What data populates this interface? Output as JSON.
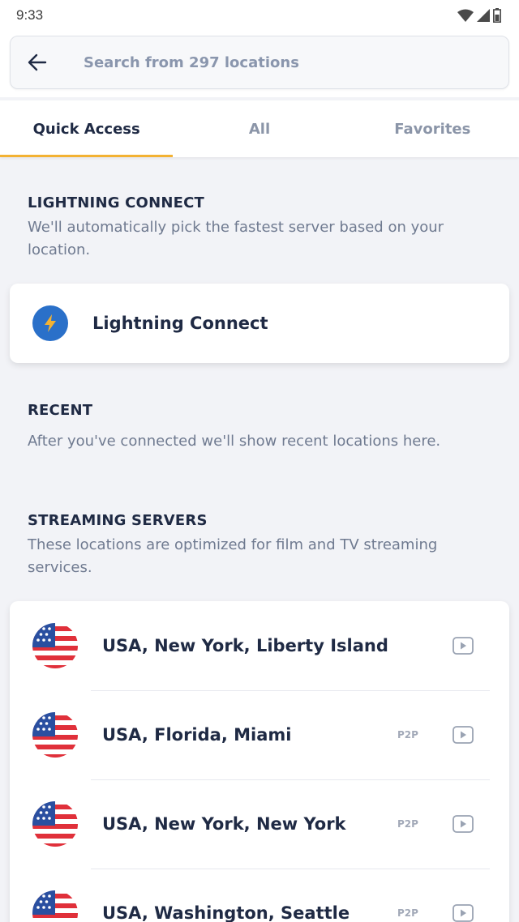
{
  "status_bar": {
    "time": "9:33"
  },
  "search": {
    "placeholder": "Search from 297 locations"
  },
  "tabs": [
    {
      "label": "Quick Access",
      "active": true
    },
    {
      "label": "All",
      "active": false
    },
    {
      "label": "Favorites",
      "active": false
    }
  ],
  "lightning": {
    "title": "LIGHTNING CONNECT",
    "description": "We'll automatically pick the fastest server based on your location.",
    "button_label": "Lightning Connect"
  },
  "recent": {
    "title": "RECENT",
    "description": "After you've connected we'll show recent locations here."
  },
  "streaming": {
    "title": "STREAMING SERVERS",
    "description": "These locations are optimized for film and TV streaming services.",
    "locations": [
      {
        "label": "USA, New York, Liberty Island",
        "p2p": ""
      },
      {
        "label": "USA, Florida, Miami",
        "p2p": "P2P"
      },
      {
        "label": "USA, New York, New York",
        "p2p": "P2P"
      },
      {
        "label": "USA, Washington, Seattle",
        "p2p": "P2P"
      }
    ]
  },
  "colors": {
    "accent": "#f3b233",
    "brand_blue": "#2a70c9",
    "text_dark": "#1f2a44",
    "text_muted": "#6f7a90"
  },
  "icons": {
    "back": "arrow-left-icon",
    "lightning": "lightning-bolt-icon",
    "stream": "play-icon",
    "flag": "usa-flag-icon"
  }
}
